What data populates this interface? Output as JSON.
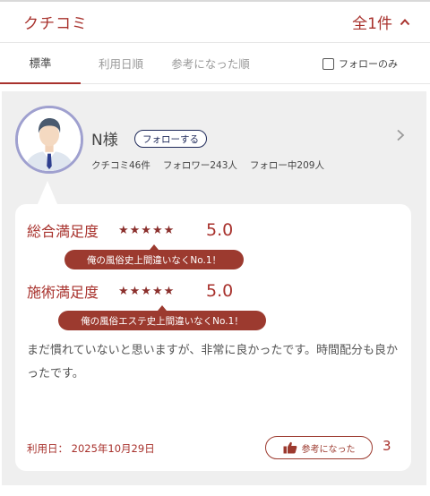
{
  "header": {
    "title": "クチコミ",
    "count": "全1件",
    "collapse_icon": "chevron-up-icon"
  },
  "tabs": [
    {
      "label": "標準",
      "active": true
    },
    {
      "label": "利用日順",
      "active": false
    },
    {
      "label": "参考になった順",
      "active": false
    }
  ],
  "filter": {
    "follow_only_label": "フォローのみ",
    "checked": false
  },
  "review": {
    "user": {
      "name": "N様",
      "follow_button": "フォローする",
      "stats": {
        "reviews": "クチコミ46件",
        "followers": "フォロワー243人",
        "following": "フォロー中209人"
      }
    },
    "ratings": [
      {
        "label": "総合満足度",
        "stars": "★★★★★",
        "value": "5.0",
        "ribbon": "俺の風俗史上間違いなくNo.1！"
      },
      {
        "label": "施術満足度",
        "stars": "★★★★★",
        "value": "5.0",
        "ribbon": "俺の風俗エステ史上間違いなくNo.1！"
      }
    ],
    "comment": "まだ慣れていないと思いますが、非常に良かったです。時間配分も良かったです。",
    "use_date": "利用日： 2025年10月29日",
    "helpful_label": "参考になった",
    "helpful_count": "3"
  },
  "colors": {
    "accent": "#a8322d",
    "ribbon": "#9c3a2f",
    "follow_border": "#1f2a5a",
    "avatar_ring": "#9fa0cf",
    "card_bg": "#efefef"
  }
}
